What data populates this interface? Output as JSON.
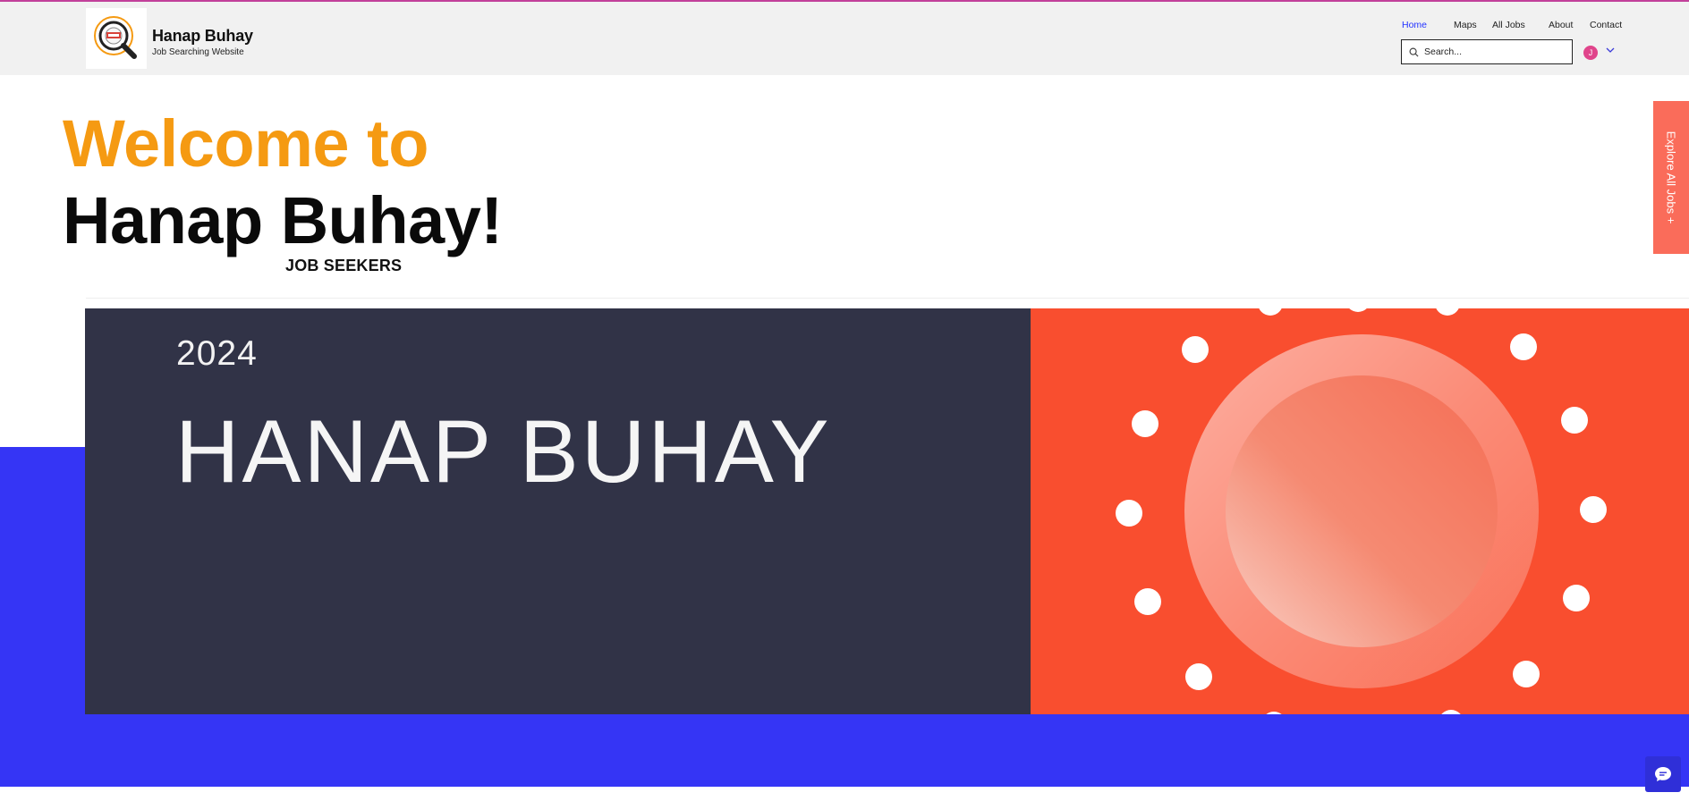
{
  "brand": {
    "name": "Hanap Buhay",
    "tagline": "Job Searching Website"
  },
  "nav": {
    "items": [
      {
        "label": "Home",
        "active": true
      },
      {
        "label": "Maps",
        "active": false
      },
      {
        "label": "All Jobs",
        "active": false
      },
      {
        "label": "About",
        "active": false
      },
      {
        "label": "Contact",
        "active": false
      }
    ]
  },
  "search": {
    "placeholder": "Search...",
    "value": ""
  },
  "user": {
    "avatar_initial": "J"
  },
  "hero": {
    "welcome": "Welcome to",
    "title": "Hanap Buhay!",
    "subtitle": "JOB SEEKERS"
  },
  "banner": {
    "year": "2024",
    "title": "HANAP BUHAY"
  },
  "side_tab": {
    "label": "Explore All Jobs +"
  },
  "icons": {
    "search": "search-icon",
    "chevron": "chevron-down-icon",
    "chat": "chat-icon",
    "logo": "magnifier-logo-icon"
  },
  "colors": {
    "accent_orange": "#f59a12",
    "nav_active": "#2434ff",
    "blue_band": "#3535f5",
    "banner_dark": "#313347",
    "banner_red": "#f94e2f",
    "side_tab": "#fa6c5a",
    "top_line": "#c2409a"
  }
}
